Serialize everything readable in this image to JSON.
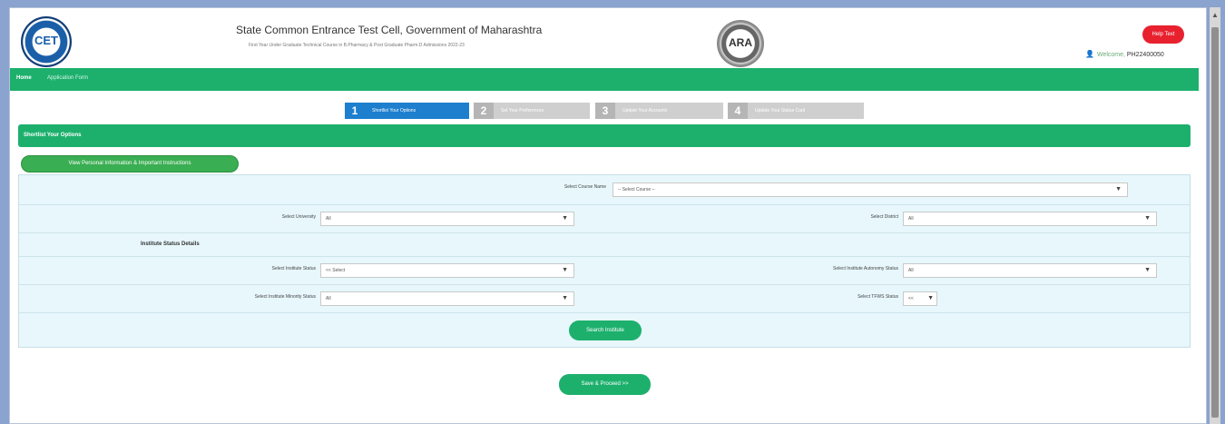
{
  "header": {
    "title": "State Common Entrance Test Cell, Government of Maharashtra",
    "subtitle": "First Year Under Graduate Technical Course in B.Pharmacy & Post Graduate Pharm.D Admissions 2022-23",
    "left_logo_text": "CET",
    "right_logo_text": "ARA",
    "help_label": "Help Text",
    "welcome_label": "Welcome,",
    "user_id": "PH22400050"
  },
  "nav": {
    "home": "Home",
    "application_form": "Application Form"
  },
  "steps": [
    {
      "num": "1",
      "label": "Shortlist Your Options"
    },
    {
      "num": "2",
      "label": "Set Your Preferences"
    },
    {
      "num": "3",
      "label": "Update Your Accounts"
    },
    {
      "num": "4",
      "label": "Update Your Status Card"
    }
  ],
  "section": {
    "title": "Shortlist Your Options",
    "instructions_button": "View Personal Information & Important Instructions"
  },
  "form": {
    "course_label": "Select Course Name",
    "course_value": "-- Select Course --",
    "university_label": "Select University",
    "university_value": "All",
    "district_label": "Select District",
    "district_value": "All",
    "status_heading": "Institute Status Details",
    "institute_status_label": "Select Institute Status",
    "institute_status_value": "<< Select",
    "autonomy_label": "Select Institute Autonomy Status",
    "autonomy_value": "All",
    "minority_label": "Select Institute Minority Status",
    "minority_value": "All",
    "tfws_label": "Select TFWS Status",
    "tfws_value": "<<",
    "search_button": "Search Institute",
    "save_button": "Save & Proceed >>"
  },
  "icons": {
    "dropdown": "chevron-down-icon",
    "user": "user-icon"
  },
  "colors": {
    "primary_green": "#1db06d",
    "active_step": "#1d7fce",
    "help_red": "#e8212f",
    "panel_bg": "#e7f7fc"
  }
}
